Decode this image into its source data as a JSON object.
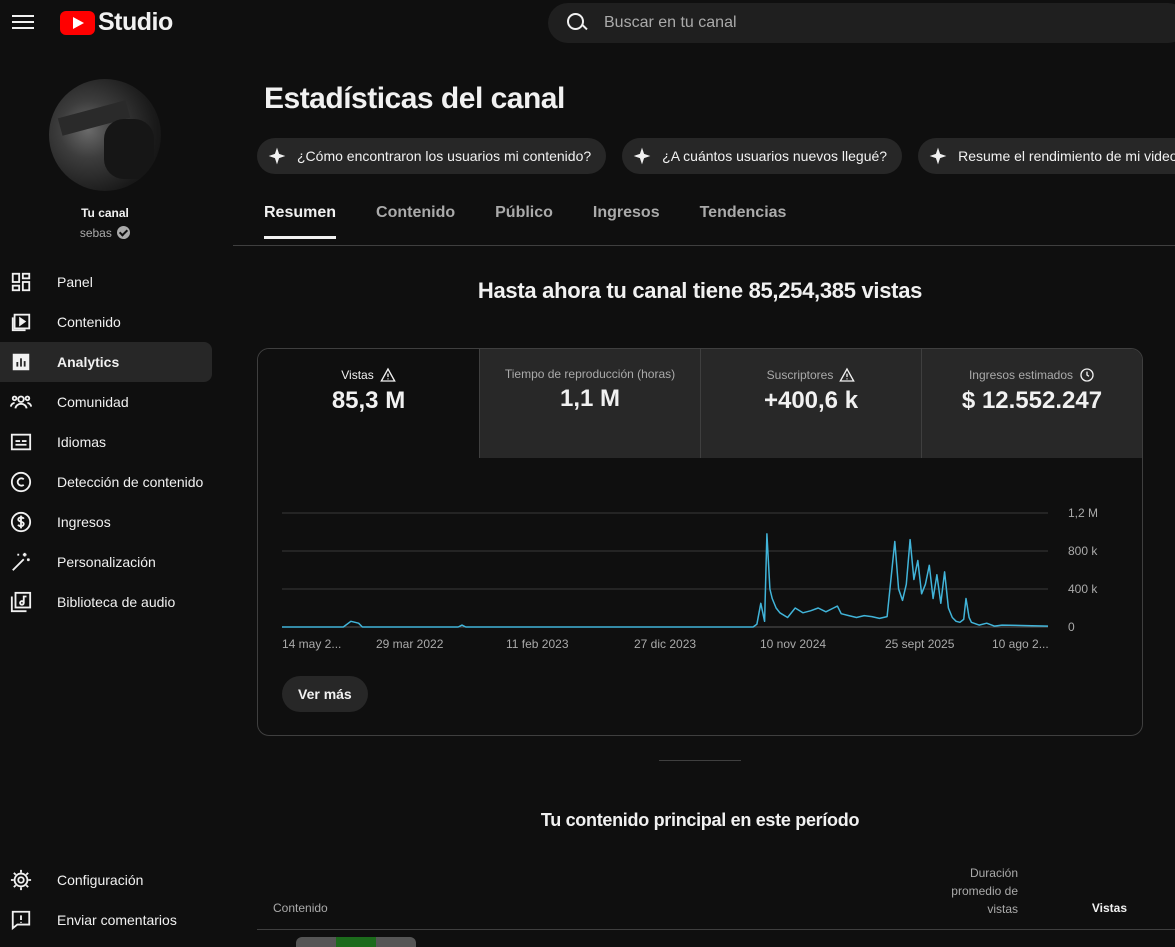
{
  "header": {
    "logo_text": "Studio",
    "search_placeholder": "Buscar en tu canal"
  },
  "sidebar": {
    "channel_label": "Tu canal",
    "channel_handle": "sebas",
    "items": [
      {
        "label": "Panel",
        "icon": "dashboard-icon"
      },
      {
        "label": "Contenido",
        "icon": "content-icon"
      },
      {
        "label": "Analytics",
        "icon": "analytics-icon",
        "active": true
      },
      {
        "label": "Comunidad",
        "icon": "community-icon"
      },
      {
        "label": "Idiomas",
        "icon": "subtitles-icon"
      },
      {
        "label": "Detección de contenido",
        "icon": "copyright-icon"
      },
      {
        "label": "Ingresos",
        "icon": "dollar-icon"
      },
      {
        "label": "Personalización",
        "icon": "magic-wand-icon"
      },
      {
        "label": "Biblioteca de audio",
        "icon": "audio-library-icon"
      }
    ],
    "bottom_items": [
      {
        "label": "Configuración",
        "icon": "gear-icon"
      },
      {
        "label": "Enviar comentarios",
        "icon": "feedback-icon"
      }
    ]
  },
  "main": {
    "title": "Estadísticas del canal",
    "chips": [
      "¿Cómo encontraron los usuarios mi contenido?",
      "¿A cuántos usuarios nuevos llegué?",
      "Resume el rendimiento de mi video"
    ],
    "tabs": [
      "Resumen",
      "Contenido",
      "Público",
      "Ingresos",
      "Tendencias"
    ],
    "active_tab": "Resumen",
    "headline": "Hasta ahora tu canal tiene 85,254,385 vistas",
    "metrics": [
      {
        "label": "Vistas",
        "value": "85,3 M",
        "icon": "warning-icon"
      },
      {
        "label": "Tiempo de reproducción (horas)",
        "value": "1,1 M",
        "icon": ""
      },
      {
        "label": "Suscriptores",
        "value": "+400,6 k",
        "icon": "warning-icon"
      },
      {
        "label": "Ingresos estimados",
        "value": "$ 12.552.247",
        "icon": "clock-icon"
      }
    ],
    "ver_mas": "Ver más",
    "section_title": "Tu contenido principal en este período",
    "table_headers": {
      "content": "Contenido",
      "duration": "Duración promedio de vistas",
      "views": "Vistas"
    }
  },
  "colors": {
    "accent": "#3ea6ff",
    "line": "#41b4d9",
    "brand_red": "#ff0000"
  },
  "chart_data": {
    "type": "line",
    "x_labels": [
      "14 may 2...",
      "29 mar 2022",
      "11 feb 2023",
      "27 dic 2023",
      "10 nov 2024",
      "25 sept 2025",
      "10 ago 2..."
    ],
    "y_ticks": [
      "1,2 M",
      "800 k",
      "400 k",
      "0"
    ],
    "ylim": [
      0,
      1200000
    ],
    "grid": true,
    "series": [
      {
        "values": [
          [
            0,
            0
          ],
          [
            0.08,
            0
          ],
          [
            0.09,
            60000
          ],
          [
            0.1,
            40000
          ],
          [
            0.105,
            0
          ],
          [
            0.23,
            0
          ],
          [
            0.235,
            20000
          ],
          [
            0.24,
            0
          ],
          [
            0.6,
            0
          ],
          [
            0.615,
            0
          ],
          [
            0.62,
            30000
          ],
          [
            0.625,
            250000
          ],
          [
            0.63,
            60000
          ],
          [
            0.633,
            980000
          ],
          [
            0.637,
            400000
          ],
          [
            0.64,
            300000
          ],
          [
            0.645,
            200000
          ],
          [
            0.65,
            150000
          ],
          [
            0.66,
            100000
          ],
          [
            0.67,
            200000
          ],
          [
            0.68,
            150000
          ],
          [
            0.69,
            170000
          ],
          [
            0.7,
            200000
          ],
          [
            0.71,
            160000
          ],
          [
            0.72,
            200000
          ],
          [
            0.725,
            220000
          ],
          [
            0.73,
            140000
          ],
          [
            0.74,
            120000
          ],
          [
            0.75,
            100000
          ],
          [
            0.76,
            120000
          ],
          [
            0.77,
            110000
          ],
          [
            0.78,
            90000
          ],
          [
            0.79,
            110000
          ],
          [
            0.8,
            900000
          ],
          [
            0.805,
            400000
          ],
          [
            0.81,
            280000
          ],
          [
            0.815,
            450000
          ],
          [
            0.82,
            920000
          ],
          [
            0.825,
            500000
          ],
          [
            0.83,
            700000
          ],
          [
            0.835,
            350000
          ],
          [
            0.84,
            450000
          ],
          [
            0.845,
            650000
          ],
          [
            0.85,
            300000
          ],
          [
            0.855,
            550000
          ],
          [
            0.86,
            250000
          ],
          [
            0.865,
            580000
          ],
          [
            0.87,
            200000
          ],
          [
            0.875,
            100000
          ],
          [
            0.88,
            60000
          ],
          [
            0.885,
            50000
          ],
          [
            0.89,
            80000
          ],
          [
            0.893,
            300000
          ],
          [
            0.897,
            100000
          ],
          [
            0.9,
            50000
          ],
          [
            0.91,
            20000
          ],
          [
            0.92,
            40000
          ],
          [
            0.93,
            10000
          ],
          [
            0.94,
            20000
          ],
          [
            1.0,
            10000
          ]
        ]
      }
    ]
  }
}
